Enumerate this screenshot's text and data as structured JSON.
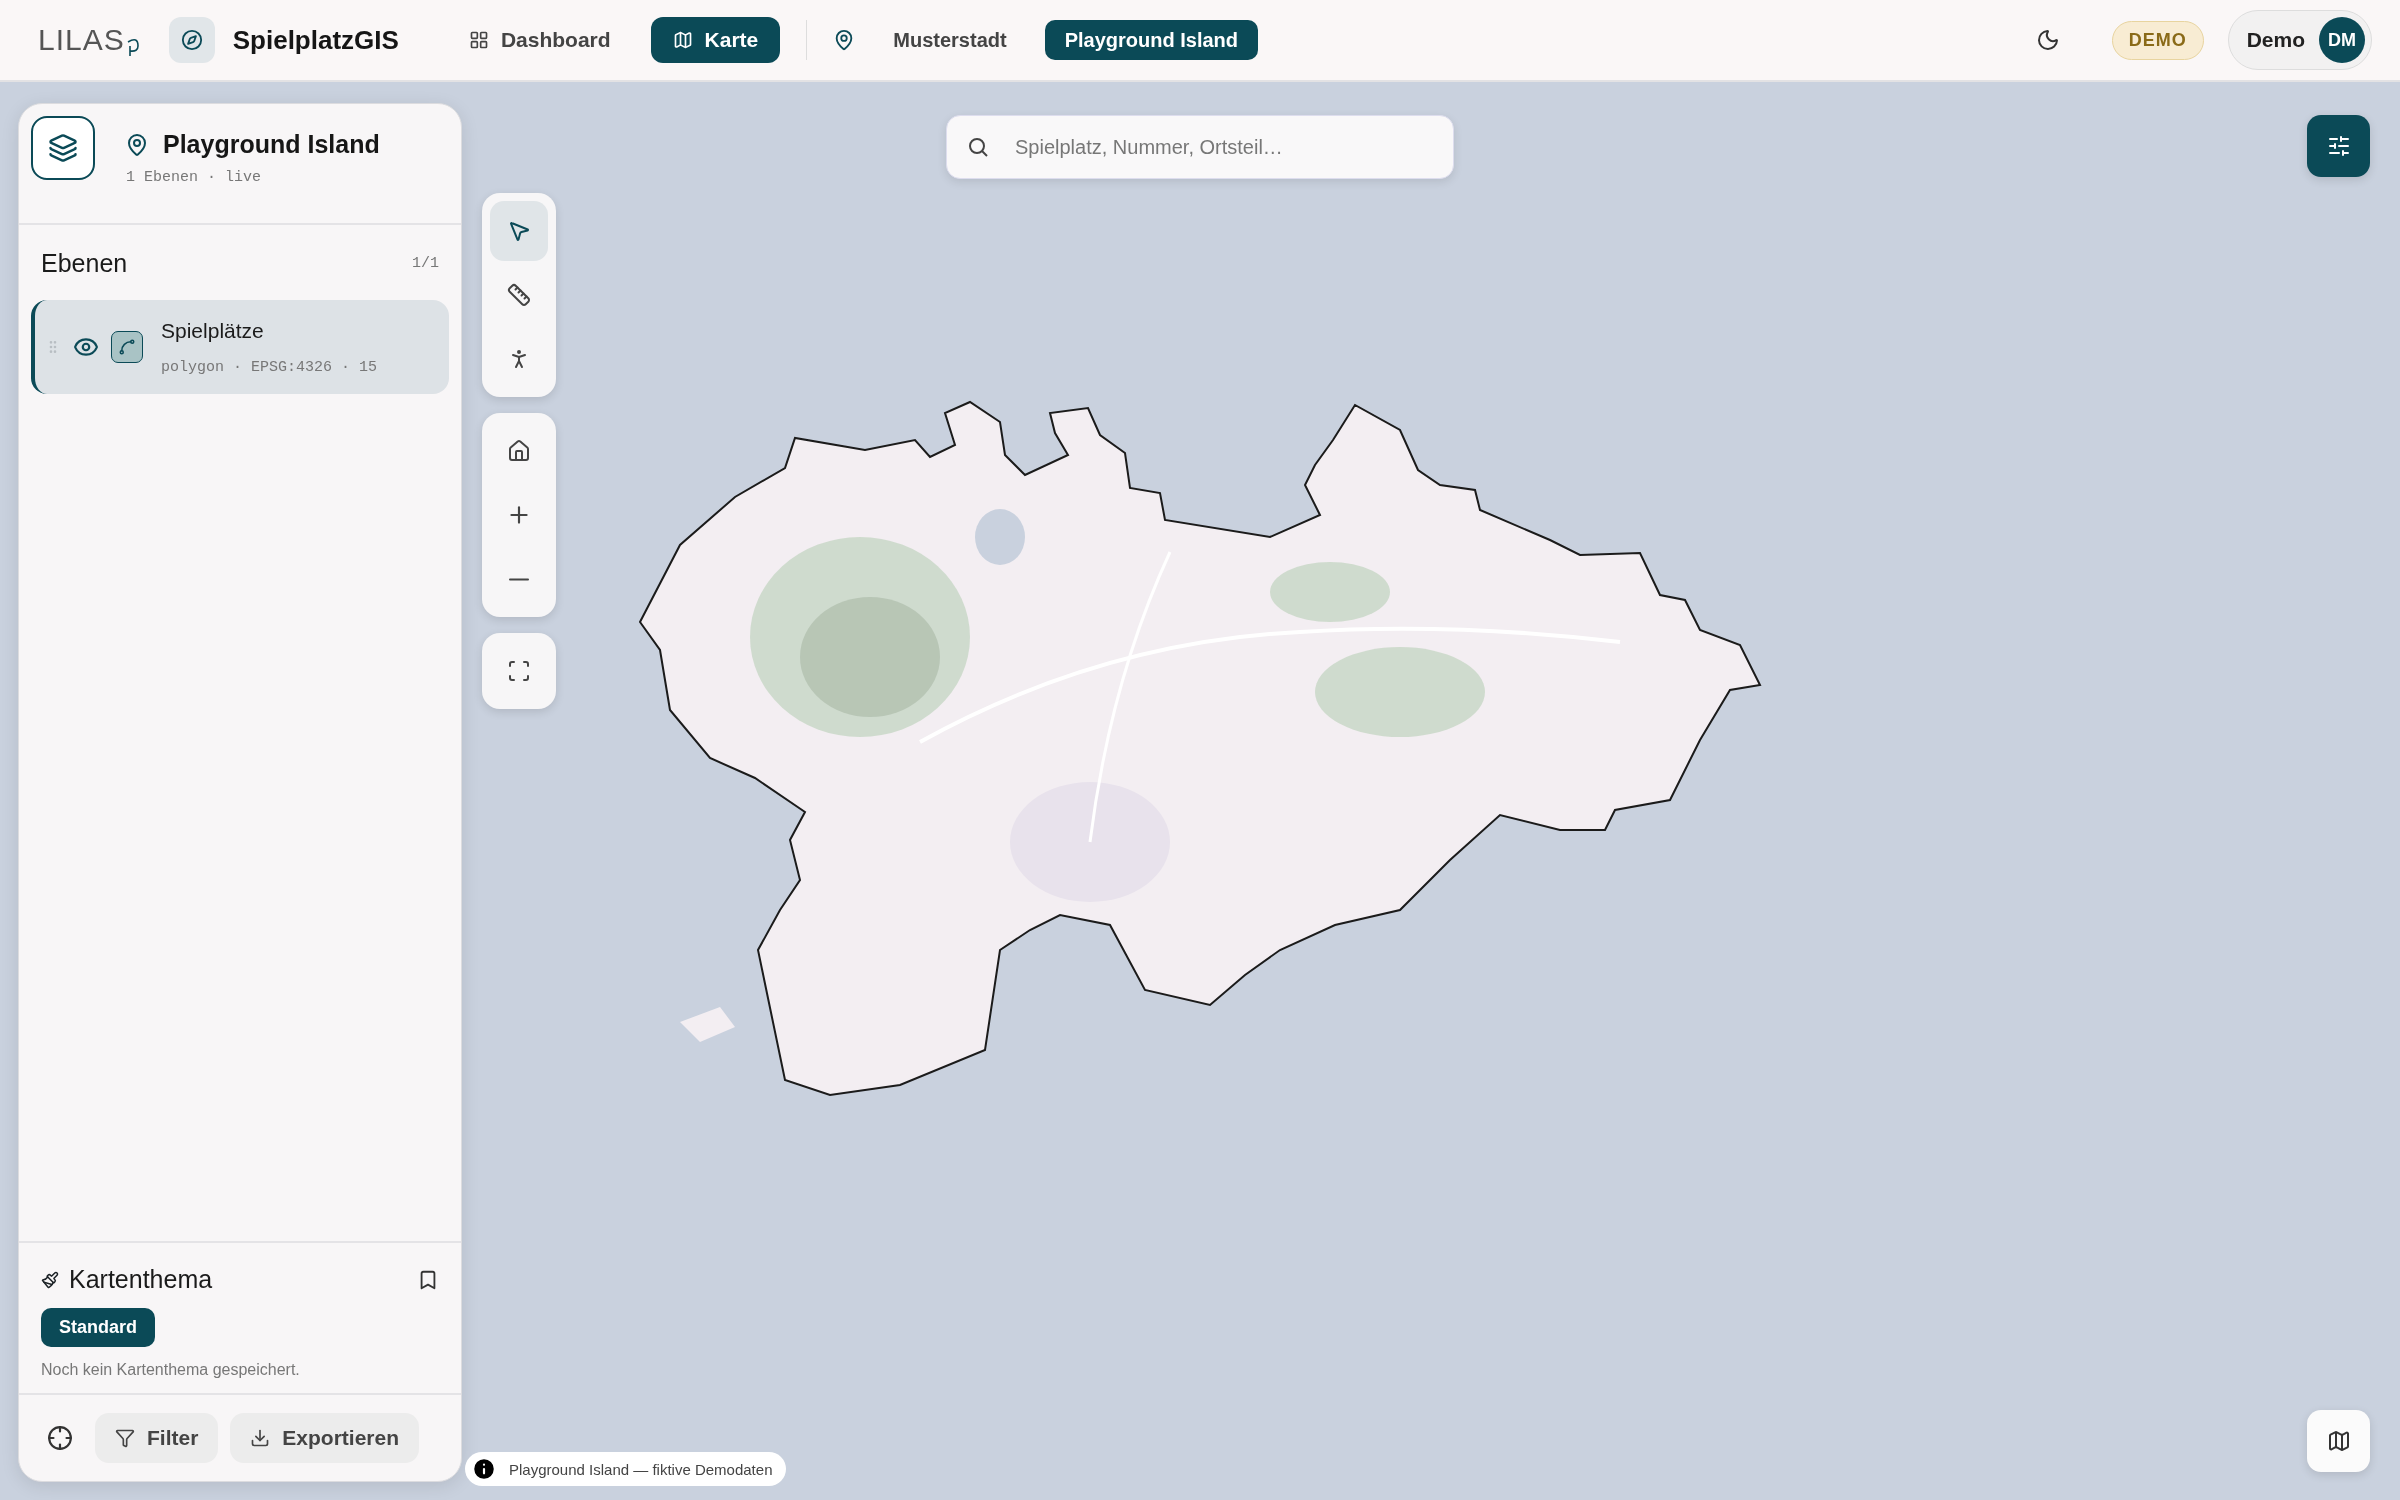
{
  "app": {
    "logo": "LILAS",
    "name": "SpielplatzGIS"
  },
  "nav": [
    {
      "label": "Dashboard",
      "selected": false
    },
    {
      "label": "Karte",
      "selected": true
    }
  ],
  "locations": [
    {
      "label": "Musterstadt",
      "selected": false
    },
    {
      "label": "Playground Island",
      "selected": true
    }
  ],
  "badge": "DEMO",
  "user": {
    "name": "Demo",
    "initials": "DM"
  },
  "panel": {
    "title": "Playground Island",
    "subtitle": "1 Ebenen · live",
    "layers_heading": "Ebenen",
    "layers_count": "1/1",
    "layers": [
      {
        "name": "Spielplätze",
        "meta": "polygon · EPSG:4326 · 15",
        "visible": true,
        "selected": true
      }
    ],
    "theme": {
      "heading": "Kartenthema",
      "themes": [
        {
          "label": "Standard",
          "selected": true
        }
      ],
      "note": "Noch kein Kartenthema gespeichert."
    },
    "actions": [
      "Filter",
      "Exportieren"
    ]
  },
  "tools": [
    {
      "kind": "select",
      "selected": true
    },
    {
      "kind": "measure",
      "selected": false
    },
    {
      "kind": "walk",
      "selected": false
    }
  ],
  "search": {
    "placeholder": "Spielplatz, Nummer, Ortsteil…"
  },
  "attribution": "Playground Island — fiktive Demodaten"
}
